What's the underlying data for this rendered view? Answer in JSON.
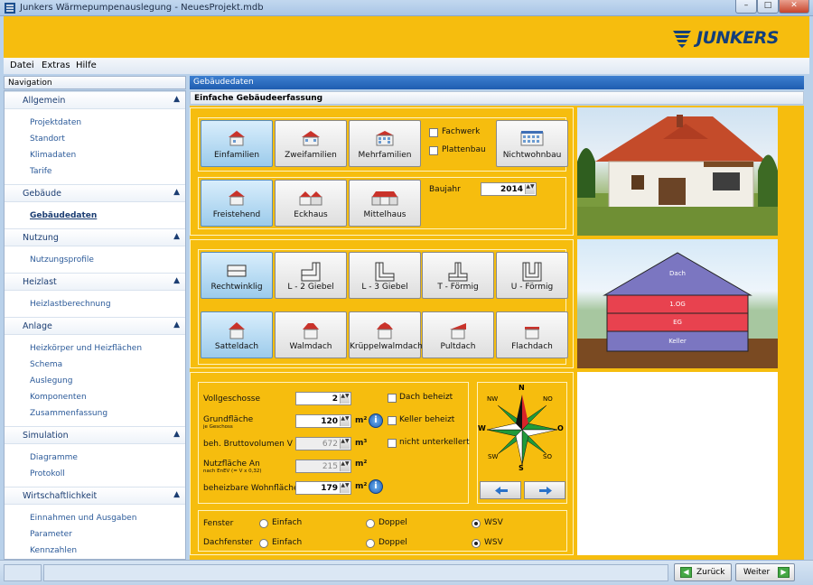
{
  "window": {
    "title": "Junkers Wärmepumpenauslegung - NeuesProjekt.mdb",
    "min_glyph": "–",
    "max_glyph": "□",
    "close_glyph": "✕"
  },
  "brand": {
    "logo_text": "JUNKERS",
    "banner_color": "#f6bd0e",
    "logo_color": "#123e7b"
  },
  "menu": [
    {
      "label": "Datei"
    },
    {
      "label": "Extras"
    },
    {
      "label": "Hilfe"
    }
  ],
  "navigation": {
    "header": "Navigation",
    "sections": [
      {
        "title": "Allgemein",
        "items": [
          "Projektdaten",
          "Standort",
          "Klimadaten",
          "Tarife"
        ]
      },
      {
        "title": "Gebäude",
        "items": [
          "Gebäudedaten"
        ]
      },
      {
        "title": "Nutzung",
        "items": [
          "Nutzungsprofile"
        ]
      },
      {
        "title": "Heizlast",
        "items": [
          "Heizlastberechnung"
        ]
      },
      {
        "title": "Anlage",
        "items": [
          "Heizkörper und Heizflächen",
          "Schema",
          "Auslegung",
          "Komponenten",
          "Zusammenfassung"
        ]
      },
      {
        "title": "Simulation",
        "items": [
          "Diagramme",
          "Protokoll"
        ]
      },
      {
        "title": "Wirtschaftlichkeit",
        "items": [
          "Einnahmen und Ausgaben",
          "Parameter",
          "Kennzahlen"
        ]
      }
    ],
    "active_item": "Gebäudedaten"
  },
  "content": {
    "header": "Gebäudedaten",
    "subheader": "Einfache Gebäudeerfassung",
    "building_type": {
      "options": [
        "Einfamilien",
        "Zweifamilien",
        "Mehrfamilien",
        "Nichtwohnbau"
      ],
      "selected": "Einfamilien"
    },
    "construction": {
      "fachwerk": "Fachwerk",
      "plattenbau": "Plattenbau"
    },
    "position": {
      "options": [
        "Freistehend",
        "Eckhaus",
        "Mittelhaus"
      ],
      "selected": "Freistehend"
    },
    "baujahr": {
      "label": "Baujahr",
      "value": "2014"
    },
    "floorplan": {
      "options": [
        "Rechtwinklig",
        "L - 2 Giebel",
        "L - 3 Giebel",
        "T - Förmig",
        "U - Förmig"
      ],
      "selected": "Rechtwinklig"
    },
    "roof": {
      "options": [
        "Satteldach",
        "Walmdach",
        "Krüppelwalmdach",
        "Pultdach",
        "Flachdach"
      ],
      "selected": "Satteldach"
    },
    "diagram": {
      "layers": [
        "Dach",
        "1.OG",
        "EG",
        "Keller"
      ]
    },
    "fields": {
      "vollgeschosse": {
        "label": "Vollgeschosse",
        "value": "2"
      },
      "grundflaeche": {
        "label": "Grundfläche",
        "sub": "je Geschoss",
        "value": "120",
        "unit": "m²"
      },
      "bruttovolumen": {
        "label": "beh. Bruttovolumen V",
        "value": "672",
        "unit": "m³"
      },
      "nutzflaeche": {
        "label": "Nutzfläche An",
        "sub": "nach EnEV (= V x 0,32)",
        "value": "215",
        "unit": "m²"
      },
      "wohnflaeche": {
        "label": "beheizbare Wohnfläche",
        "value": "179",
        "unit": "m²"
      }
    },
    "checks": {
      "dach_beheizt": "Dach beheizt",
      "keller_beheizt": "Keller beheizt",
      "nicht_unterkellert": "nicht unterkellert"
    },
    "compass": {
      "N": "N",
      "NO": "NO",
      "O": "O",
      "SO": "SO",
      "S": "S",
      "SW": "SW",
      "W": "W",
      "NW": "NW"
    },
    "windows": {
      "fenster": {
        "label": "Fenster",
        "options": [
          "Einfach",
          "Doppel",
          "WSV"
        ],
        "selected": "WSV"
      },
      "dachfenster": {
        "label": "Dachfenster",
        "options": [
          "Einfach",
          "Doppel",
          "WSV"
        ],
        "selected": "WSV"
      }
    }
  },
  "footer": {
    "back_label": "Zurück",
    "next_label": "Weiter",
    "back_arrow": "◀",
    "next_arrow": "▶"
  },
  "info_glyph": "i",
  "spin_glyph": "▲▼"
}
